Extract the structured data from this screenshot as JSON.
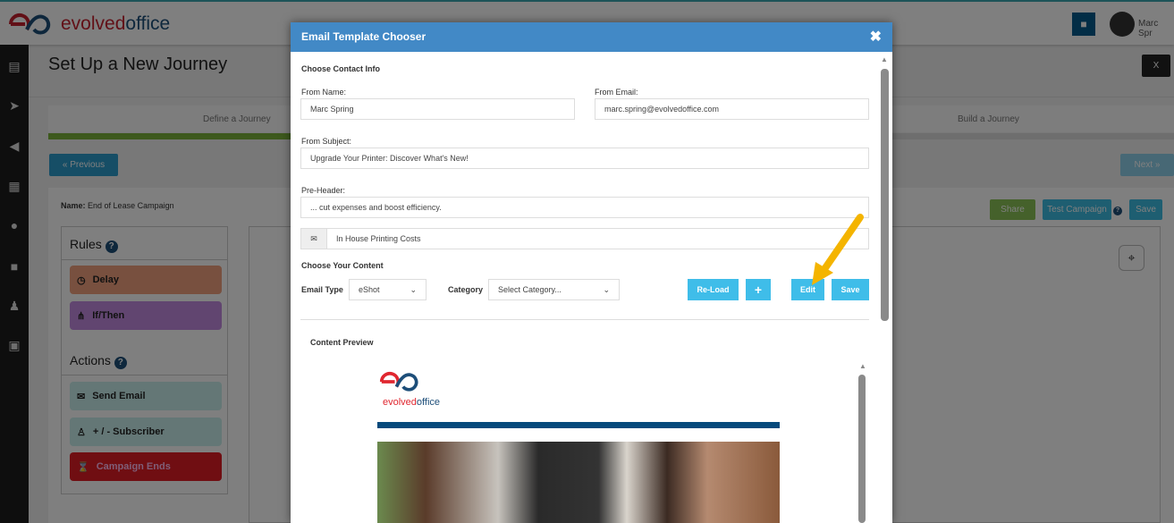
{
  "header": {
    "brand_red": "evolved",
    "brand_blue": "office",
    "user_name": "Marc Spr",
    "video_icon": "video-camera-icon"
  },
  "sidebar": {
    "icons": [
      "chart-icon",
      "send-icon",
      "megaphone-icon",
      "newspaper-icon",
      "play-icon",
      "chat-icon",
      "users-icon",
      "images-icon"
    ]
  },
  "page": {
    "title": "Set Up a New Journey",
    "close_label": "X",
    "steps": [
      "Define a Journey",
      "Build a Journey"
    ],
    "progress_percent": 25,
    "previous_label": "Previous",
    "next_label": "Next",
    "name_label": "Name:",
    "name_value": "End of Lease Campaign",
    "share_label": "Share",
    "test_label": "Test Campaign",
    "save_label": "Save",
    "rules_title": "Rules",
    "actions_title": "Actions",
    "rules": [
      {
        "label": "Delay",
        "color": "#f0a07e"
      },
      {
        "label": "If/Then",
        "color": "#c28be0"
      }
    ],
    "actions": [
      {
        "label": "Send Email",
        "color": "#c9eeec"
      },
      {
        "label": "+ / - Subscriber",
        "color": "#c9eeec"
      },
      {
        "label": "Campaign Ends",
        "color": "#e01c24"
      }
    ]
  },
  "modal": {
    "title": "Email Template Chooser",
    "contact_title": "Choose Contact Info",
    "from_name_label": "From Name:",
    "from_name": "Marc Spring",
    "from_email_label": "From Email:",
    "from_email": "marc.spring@evolvedoffice.com",
    "subject_label": "From Subject:",
    "subject": "Upgrade Your Printer: Discover What's New!",
    "preheader_label": "Pre-Header:",
    "preheader": "... cut expenses and boost efficiency.",
    "template_name": "In House Printing Costs",
    "content_title": "Choose Your Content",
    "email_type_label": "Email Type",
    "email_type": "eShot",
    "category_label": "Category",
    "category": "Select Category...",
    "reload_label": "Re-Load",
    "add_label": "+",
    "edit_label": "Edit",
    "save_label": "Save",
    "preview_title": "Content Preview",
    "preview_logo_red": "evolved",
    "preview_logo_blue": "office"
  }
}
